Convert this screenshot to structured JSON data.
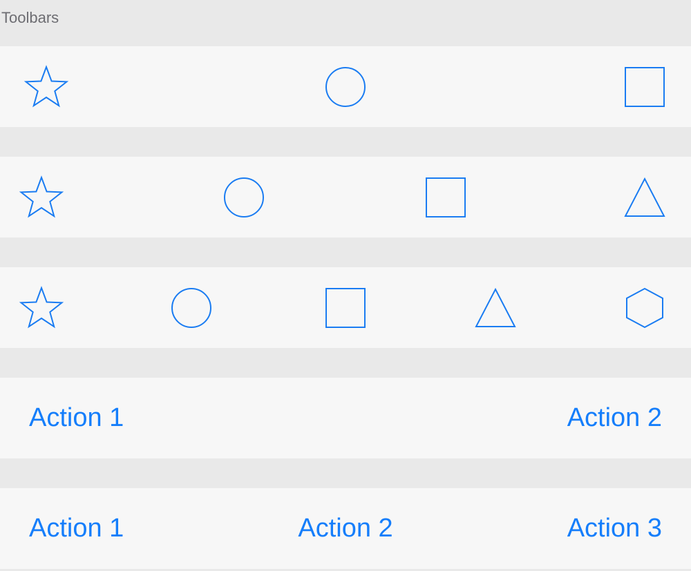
{
  "section": {
    "title": "Toolbars"
  },
  "colors": {
    "accent": "#157efb",
    "toolbar_bg": "#f7f7f7",
    "group_bg": "#e9e9e9",
    "header_text": "#6d6d72"
  },
  "toolbars": [
    {
      "items": [
        "star-icon",
        "circle-icon",
        "square-icon"
      ]
    },
    {
      "items": [
        "star-icon",
        "circle-icon",
        "square-icon",
        "triangle-icon"
      ]
    },
    {
      "items": [
        "star-icon",
        "circle-icon",
        "square-icon",
        "triangle-icon",
        "hexagon-icon"
      ]
    },
    {
      "actions": [
        "Action 1",
        "Action 2"
      ]
    },
    {
      "actions": [
        "Action 1",
        "Action 2",
        "Action 3"
      ]
    }
  ]
}
